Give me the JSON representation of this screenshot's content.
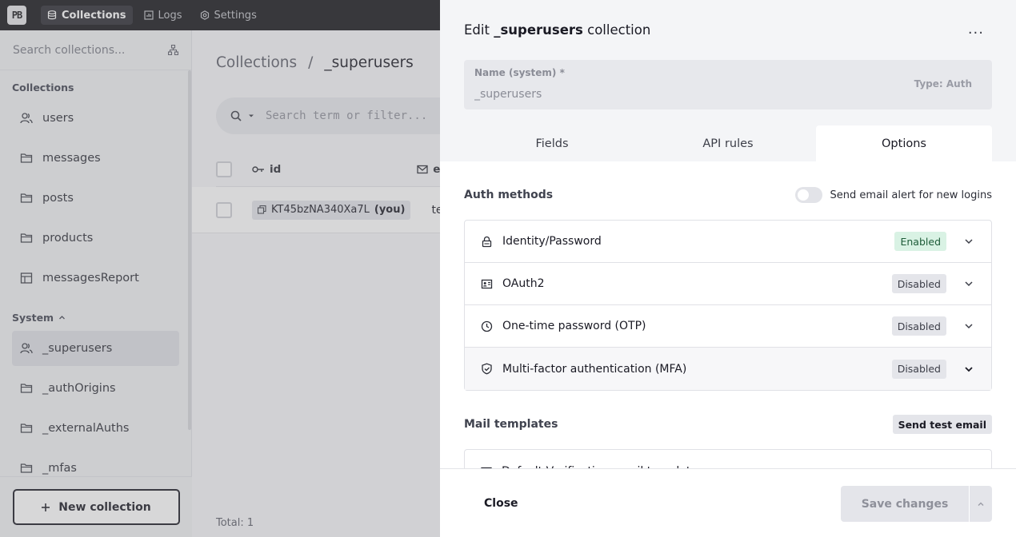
{
  "topbar": {
    "logo": "PB",
    "nav": [
      {
        "label": "Collections",
        "icon": "database-icon",
        "active": true
      },
      {
        "label": "Logs",
        "icon": "chart-icon"
      },
      {
        "label": "Settings",
        "icon": "gear-icon"
      }
    ]
  },
  "sidebar": {
    "search_placeholder": "Search collections...",
    "collections_label": "Collections",
    "collections": [
      "users",
      "messages",
      "posts",
      "products",
      "messagesReport"
    ],
    "system_label": "System",
    "system": [
      "_superusers",
      "_authOrigins",
      "_externalAuths",
      "_mfas"
    ],
    "new_collection_label": "New collection"
  },
  "main": {
    "breadcrumb_root": "Collections",
    "breadcrumb_sep": "/",
    "breadcrumb_current": "_superusers",
    "search_placeholder": "Search term or filter...",
    "col_id": "id",
    "col_email_partial": "e",
    "row": {
      "id": "KT45bzNA340Xa7L",
      "you": "(you)",
      "email_partial": "test"
    },
    "total": "Total: 1"
  },
  "panel": {
    "title_prefix": "Edit",
    "title_name": "_superusers",
    "title_suffix": "collection",
    "dots": "...",
    "name_label": "Name (system) *",
    "name_value": "_superusers",
    "type_label": "Type: Auth",
    "tabs": [
      "Fields",
      "API rules",
      "Options"
    ],
    "active_tab": "Options",
    "auth_methods_label": "Auth methods",
    "email_alert_label": "Send email alert for new logins",
    "auth_methods": [
      {
        "name": "Identity/Password",
        "status": "Enabled",
        "icon": "lock-icon"
      },
      {
        "name": "OAuth2",
        "status": "Disabled",
        "icon": "id-card-icon"
      },
      {
        "name": "One-time password (OTP)",
        "status": "Disabled",
        "icon": "clock-icon"
      },
      {
        "name": "Multi-factor authentication (MFA)",
        "status": "Disabled",
        "icon": "shield-icon"
      }
    ],
    "mail_templates_label": "Mail templates",
    "send_test_email_label": "Send test email",
    "mail_template_partial": "Default Verification email template",
    "close_label": "Close",
    "save_label": "Save changes"
  }
}
